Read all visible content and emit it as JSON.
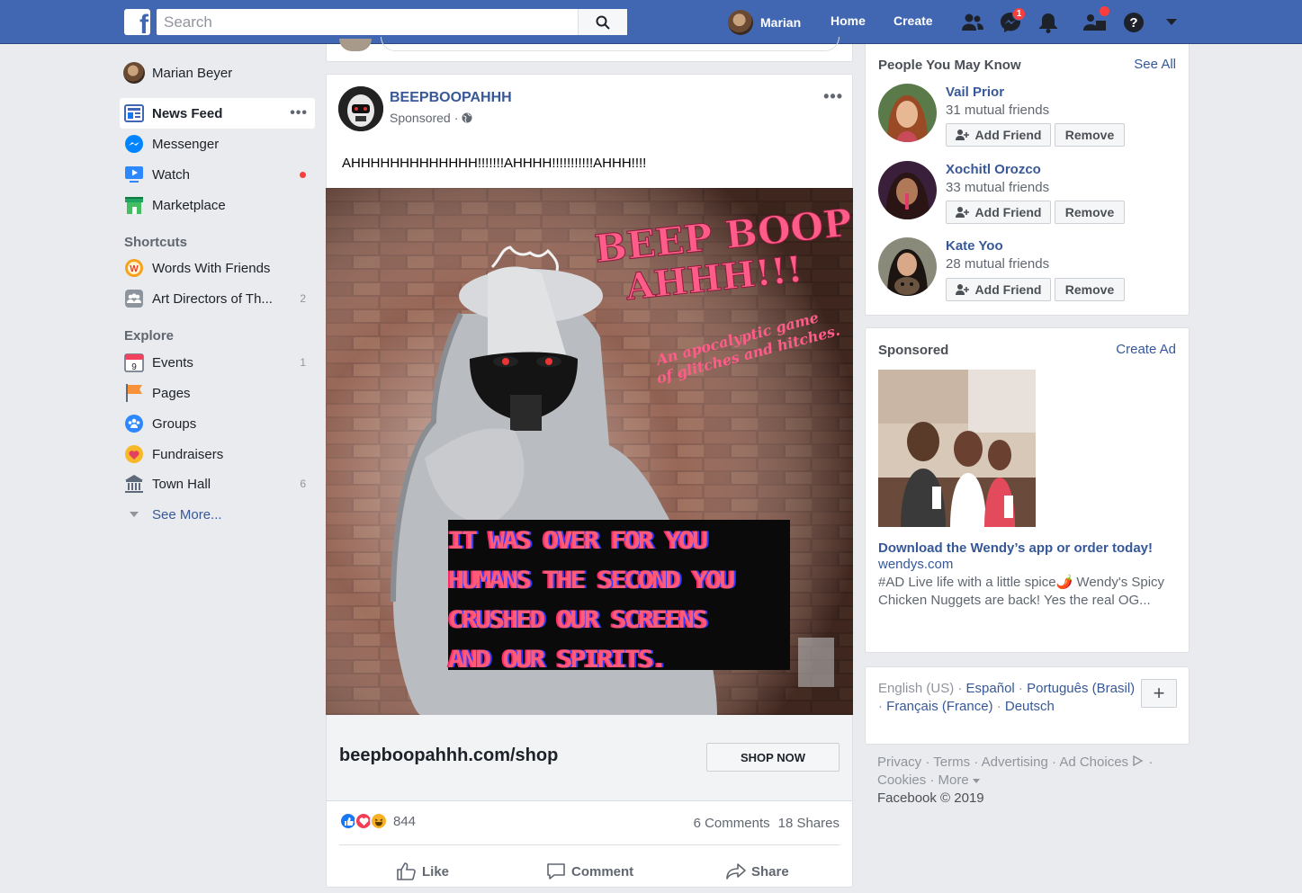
{
  "topbar": {
    "search_placeholder": "Search",
    "user_name": "Marian",
    "home": "Home",
    "create": "Create",
    "messenger_badge": "1",
    "brand_color": "#4267b2"
  },
  "left_nav": {
    "profile_name": "Marian Beyer",
    "items": [
      {
        "label": "News Feed",
        "icon": "news-feed-icon"
      },
      {
        "label": "Messenger",
        "icon": "messenger-icon"
      },
      {
        "label": "Watch",
        "icon": "watch-icon"
      },
      {
        "label": "Marketplace",
        "icon": "marketplace-icon"
      }
    ],
    "shortcuts_heading": "Shortcuts",
    "shortcuts": [
      {
        "label": "Words With Friends",
        "icon": "words-with-friends-icon"
      },
      {
        "label": "Art Directors of Th...",
        "count": "2",
        "icon": "group-icon"
      }
    ],
    "explore_heading": "Explore",
    "explore": [
      {
        "label": "Events",
        "count": "1",
        "icon": "calendar-icon"
      },
      {
        "label": "Pages",
        "icon": "flag-icon"
      },
      {
        "label": "Groups",
        "icon": "groups-icon"
      },
      {
        "label": "Fundraisers",
        "icon": "heart-icon"
      },
      {
        "label": "Town Hall",
        "count": "6",
        "icon": "town-hall-icon"
      }
    ],
    "see_more": "See More..."
  },
  "post": {
    "page_name": "BEEPBOOPAHHH",
    "sponsored": "Sponsored",
    "text": "AHHHHHHHHHHHHH!!!!!!!AHHHH!!!!!!!!!!!AHHH!!!!",
    "image": {
      "title": "BEEP BOOP AHHH!!!",
      "tagline_1": "An apocalyptic game",
      "tagline_2": "of glitches and hitches.",
      "glitch_lines": [
        "IT WAS OVER FOR YOU",
        "HUMANS THE SECOND YOU",
        "CRUSHED OUR SCREENS",
        "AND OUR SPIRITS."
      ]
    },
    "link_url": "beepboopahhh.com/shop",
    "cta": "SHOP NOW",
    "reaction_count": "844",
    "comments": "6 Comments",
    "shares": "18 Shares",
    "actions": {
      "like": "Like",
      "comment": "Comment",
      "share": "Share"
    }
  },
  "pymk": {
    "title": "People You May Know",
    "see_all": "See All",
    "add_label": "Add Friend",
    "remove_label": "Remove",
    "people": [
      {
        "name": "Vail Prior",
        "mutual": "31 mutual friends"
      },
      {
        "name": "Xochitl Orozco",
        "mutual": "33 mutual friends"
      },
      {
        "name": "Kate Yoo",
        "mutual": "28 mutual friends"
      }
    ]
  },
  "sponsored": {
    "title": "Sponsored",
    "create_ad": "Create Ad",
    "ad_title": "Download the Wendy’s app or order today!",
    "domain": "wendys.com",
    "body": "#AD Live life with a little spice🌶️ Wendy's Spicy Chicken Nuggets are back! Yes the real OG..."
  },
  "languages": {
    "current": "English (US)",
    "others": [
      "Español",
      "Português (Brasil)",
      "Français (France)",
      "Deutsch"
    ]
  },
  "footer": {
    "links": [
      "Privacy",
      "Terms",
      "Advertising",
      "Ad Choices",
      "Cookies",
      "More"
    ],
    "copyright": "Facebook © 2019"
  }
}
